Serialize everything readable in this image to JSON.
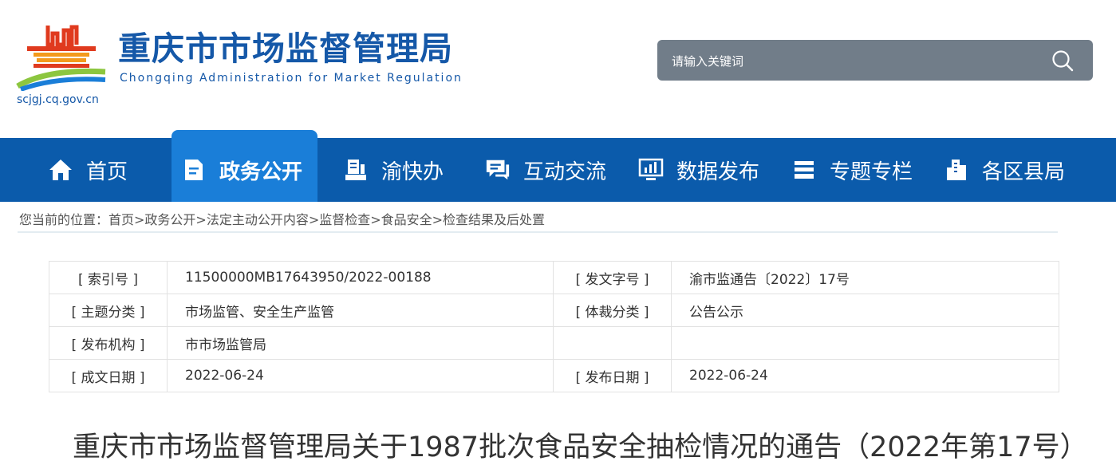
{
  "header": {
    "title": "重庆市市场监督管理局",
    "subtitle": "Chongqing  Administration for Market Regulation",
    "domain": "scjgj.cq.gov.cn"
  },
  "search": {
    "placeholder": "请输入关键词"
  },
  "nav": {
    "items": [
      {
        "label": "首页",
        "icon": "home-icon"
      },
      {
        "label": "政务公开",
        "icon": "document-icon"
      },
      {
        "label": "渝快办",
        "icon": "print-icon"
      },
      {
        "label": "互动交流",
        "icon": "chat-icon"
      },
      {
        "label": "数据发布",
        "icon": "chart-monitor-icon"
      },
      {
        "label": "专题专栏",
        "icon": "stack-icon"
      },
      {
        "label": "各区县局",
        "icon": "building-icon"
      }
    ],
    "active_index": 1
  },
  "breadcrumb": "您当前的位置：首页>政务公开>法定主动公开内容>监督检查>食品安全>检查结果及后处置",
  "meta": {
    "rows": [
      {
        "l1": "[ 索引号 ]",
        "v1": "11500000MB17643950/2022-00188",
        "l2": "[ 发文字号 ]",
        "v2": "渝市监通告〔2022〕17号"
      },
      {
        "l1": "[ 主题分类 ]",
        "v1": "市场监管、安全生产监管",
        "l2": "[ 体裁分类 ]",
        "v2": "公告公示"
      },
      {
        "l1": "[ 发布机构 ]",
        "v1": "市市场监管局",
        "l2": "",
        "v2": ""
      },
      {
        "l1": "[ 成文日期 ]",
        "v1": "2022-06-24",
        "l2": "[ 发布日期 ]",
        "v2": "2022-06-24"
      }
    ]
  },
  "document": {
    "title": "重庆市市场监督管理局关于1987批次食品安全抽检情况的通告（2022年第17号）"
  },
  "colors": {
    "nav_bg": "#0b5bab",
    "nav_active": "#1a7ed8",
    "brand_blue": "#1558a8",
    "search_bg": "#717d89"
  }
}
